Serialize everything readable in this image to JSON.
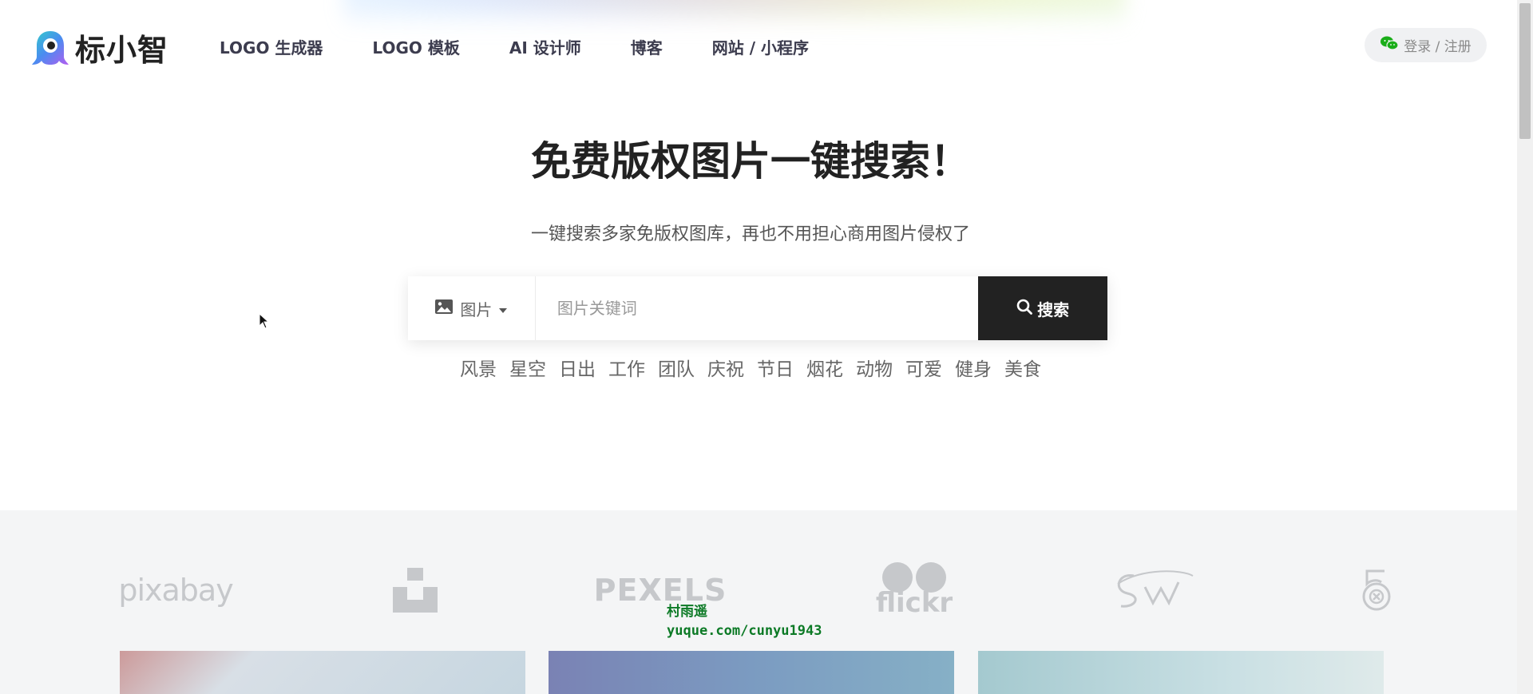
{
  "brand": {
    "name": "标小智"
  },
  "nav": {
    "items": [
      "LOGO 生成器",
      "LOGO 模板",
      "AI 设计师",
      "博客",
      "网站 / 小程序"
    ]
  },
  "login": {
    "label": "登录 / 注册",
    "icon": "wechat-icon",
    "icon_color": "#1aad19"
  },
  "hero": {
    "title": "免费版权图片一键搜索！",
    "subtitle": "一键搜索多家免版权图库，再也不用担心商用图片侵权了"
  },
  "search": {
    "type_label": "图片",
    "type_icon": "image-icon",
    "placeholder": "图片关键词",
    "value": "",
    "button_label": "搜索",
    "button_icon": "search-icon"
  },
  "tags": [
    "风景",
    "星空",
    "日出",
    "工作",
    "团队",
    "庆祝",
    "节日",
    "烟花",
    "动物",
    "可爱",
    "健身",
    "美食"
  ],
  "sources": {
    "logos": [
      {
        "name": "pixabay",
        "text": "pixabay"
      },
      {
        "name": "unsplash",
        "text": ""
      },
      {
        "name": "pexels",
        "text": "PEXELS"
      },
      {
        "name": "flickr",
        "text": "flickr"
      },
      {
        "name": "stocksnap",
        "text": ""
      },
      {
        "name": "500px",
        "text": ""
      }
    ]
  },
  "watermark": {
    "line1": "村雨遥",
    "line2": "yuque.com/cunyu1943"
  },
  "colors": {
    "accent_dark": "#222222",
    "section_bg": "#f4f5f6",
    "logo_gray": "#c6c8cb"
  }
}
